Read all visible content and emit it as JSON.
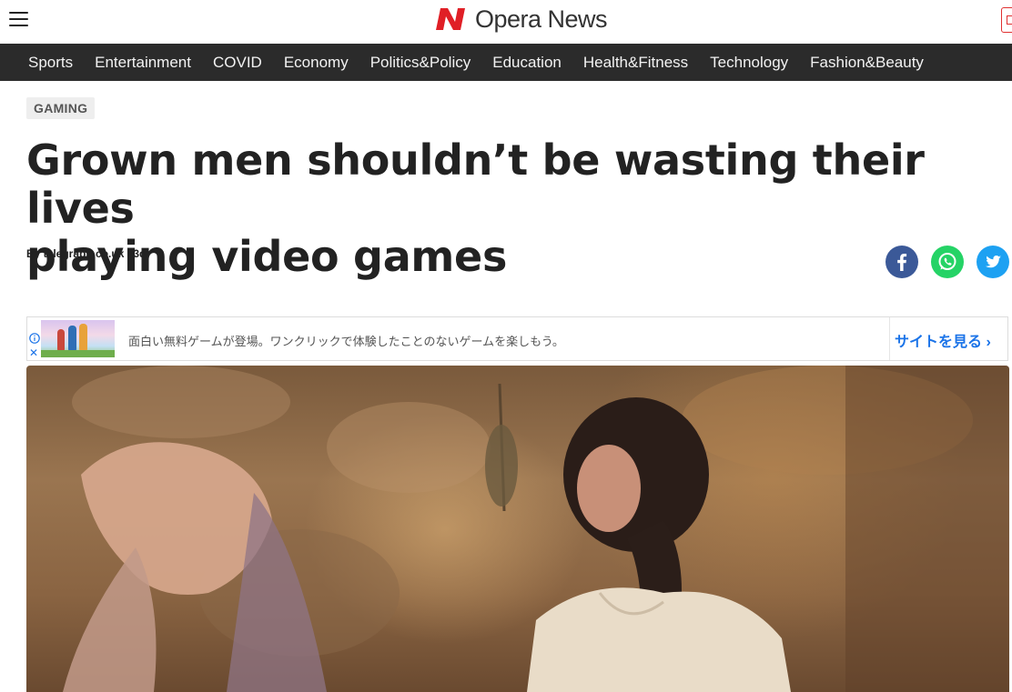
{
  "header": {
    "brand_name": "Opera News",
    "brand_color": "#e01f26"
  },
  "nav": {
    "items": [
      "Sports",
      "Entertainment",
      "COVID",
      "Economy",
      "Politics&Policy",
      "Education",
      "Health&Fitness",
      "Technology",
      "Fashion&Beauty"
    ]
  },
  "article": {
    "category": "GAMING",
    "title_line1": "Grown men shouldn’t be wasting their lives",
    "title_line2": "playing video games",
    "source": "telegraph.co.uk",
    "age": "3d",
    "byline": "By telegraph.co.uk | 3d"
  },
  "share": {
    "icons": [
      "facebook-icon",
      "whatsapp-icon",
      "twitter-icon"
    ],
    "colors": {
      "facebook": "#3b5998",
      "whatsapp": "#25d366",
      "twitter": "#1da1f2"
    }
  },
  "ad": {
    "text": "面白い無料ゲームが登場。ワンクリックで体験したことのないゲームを楽しもう。",
    "cta": "サイトを見る",
    "cta_color": "#1a73e8"
  }
}
